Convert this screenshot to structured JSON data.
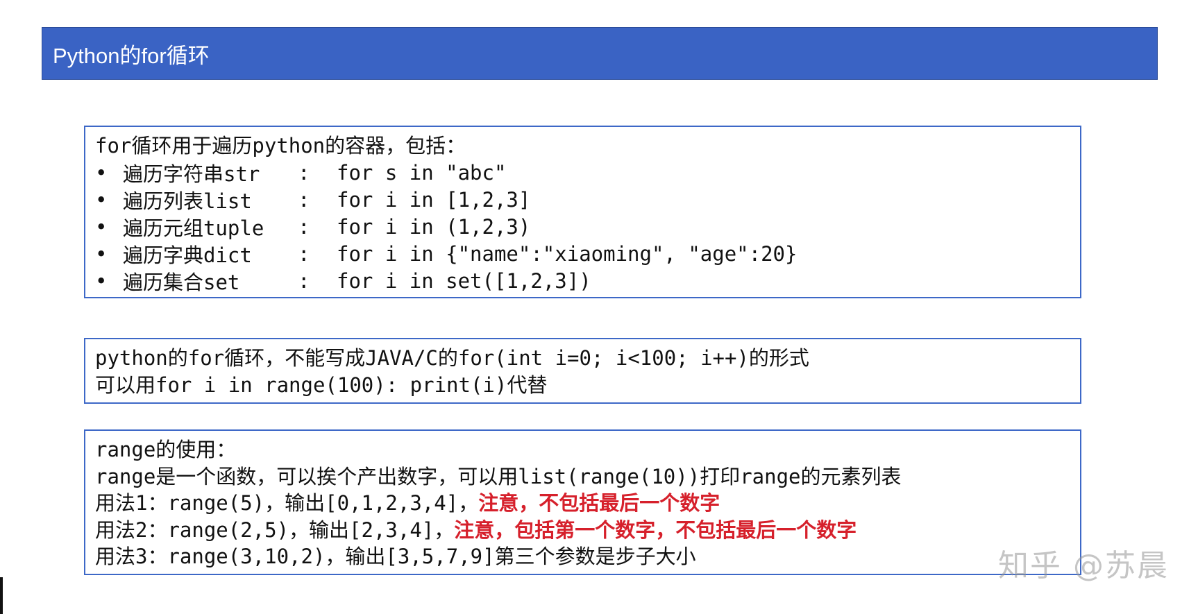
{
  "title": "Python的for循环",
  "box1": {
    "heading": "for循环用于遍历python的容器，包括：",
    "bullet_symbol": "•",
    "separator": ":",
    "items": [
      {
        "label": "遍历字符串str",
        "code": "for s in \"abc\""
      },
      {
        "label": "遍历列表list",
        "code": "for i in [1,2,3]"
      },
      {
        "label": "遍历元组tuple",
        "code": "for i in (1,2,3)"
      },
      {
        "label": "遍历字典dict",
        "code": "for i in {\"name\":\"xiaoming\", \"age\":20}"
      },
      {
        "label": "遍历集合set",
        "code": "for i in set([1,2,3])"
      }
    ]
  },
  "box2": {
    "lines": [
      "python的for循环，不能写成JAVA/C的for(int i=0; i<100; i++)的形式",
      "可以用for i in range(100): print(i)代替"
    ]
  },
  "box3": {
    "heading": "range的使用：",
    "desc": "range是一个函数，可以挨个产出数字，可以用list(range(10))打印range的元素列表",
    "usage1": {
      "text": "用法1：range(5)，输出[0,1,2,3,4]，",
      "note": "注意，不包括最后一个数字"
    },
    "usage2": {
      "text": "用法2：range(2,5)，输出[2,3,4]，",
      "note": "注意，包括第一个数字，不包括最后一个数字"
    },
    "usage3": {
      "text": "用法3：range(3,10,2)，输出[3,5,7,9]第三个参数是步子大小"
    }
  },
  "watermark": "知乎 @苏晨",
  "colors": {
    "title_bar": "#3a63c4",
    "box_border": "#3d68c7",
    "note_red": "#d6202b"
  }
}
